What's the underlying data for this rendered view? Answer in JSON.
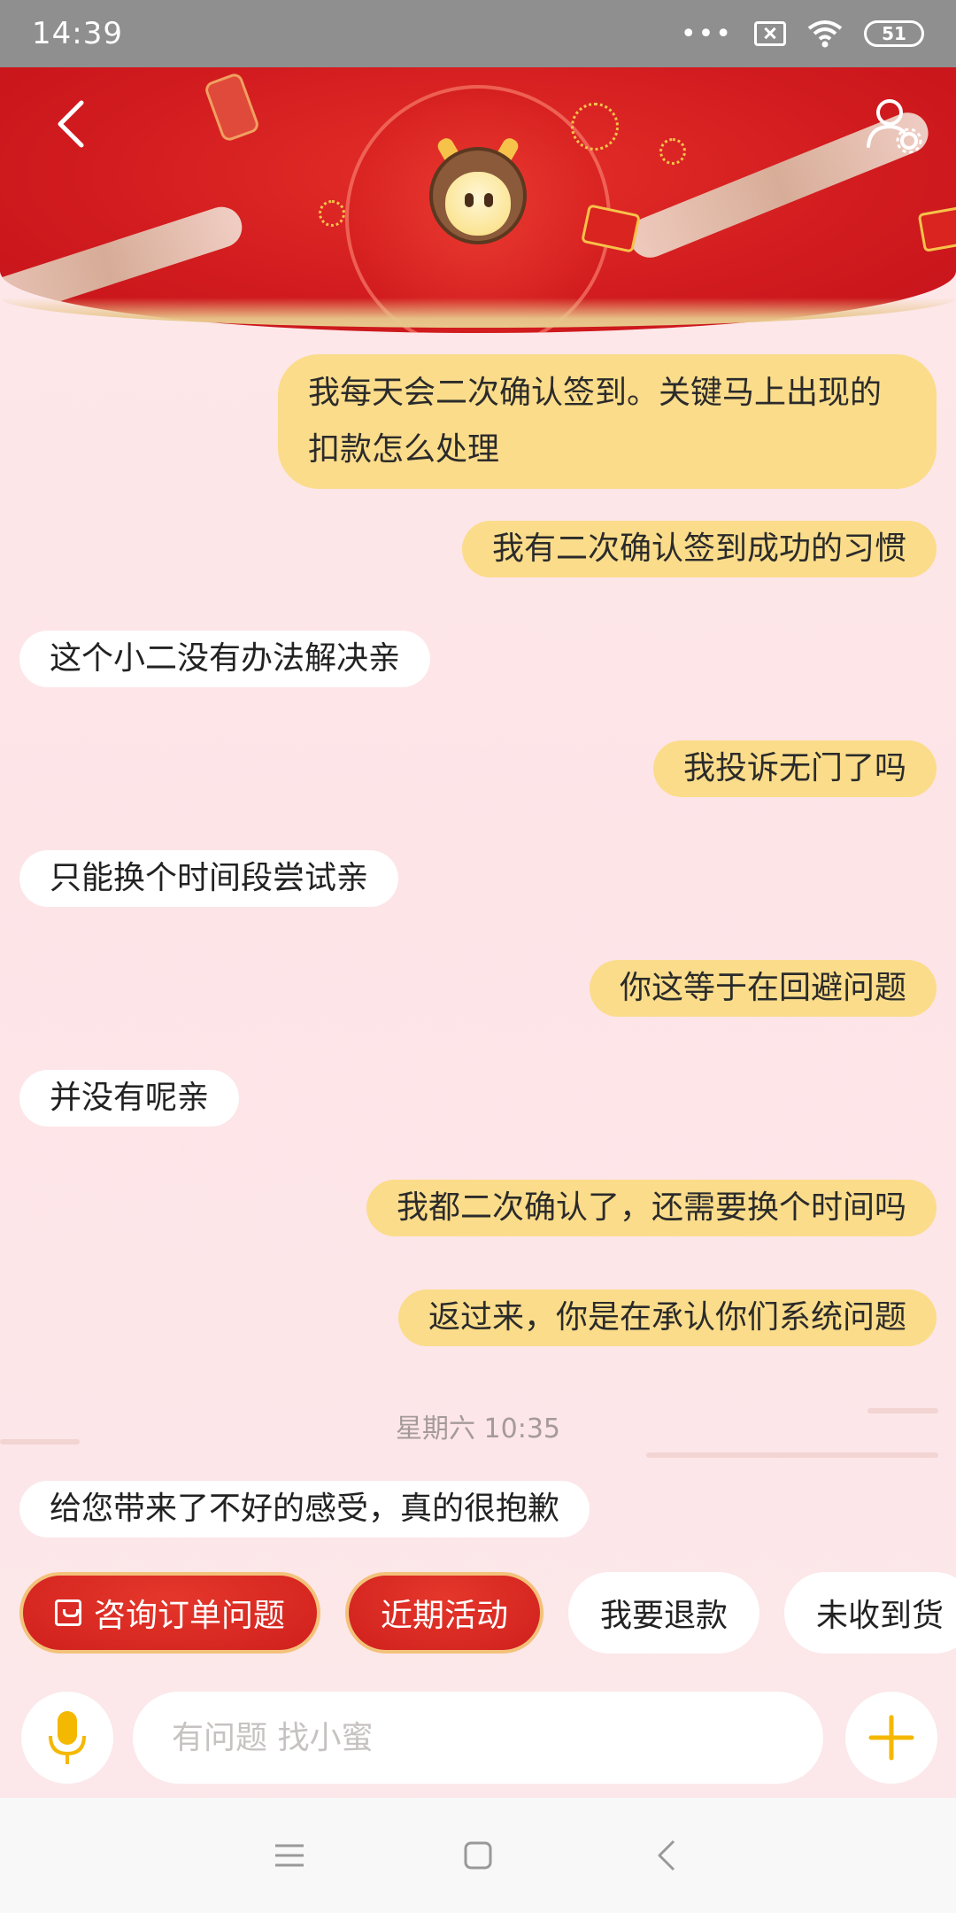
{
  "status_bar": {
    "time": "14:39",
    "more": "•••",
    "battery": "51",
    "icons": [
      "sim-off-icon",
      "wifi-icon",
      "battery-icon"
    ]
  },
  "header": {
    "back_icon": "chevron-left-icon",
    "settings_icon": "user-settings-icon",
    "mascot": "ox-mascot-avatar",
    "theme_colors": {
      "primary": "#d21c1f",
      "gold": "#e8c88c"
    }
  },
  "messages": [
    {
      "side": "out",
      "text": "我每天会二次确认签到。关键马上出现的扣款怎么处理"
    },
    {
      "side": "out",
      "text": "我有二次确认签到成功的习惯"
    },
    {
      "side": "in",
      "text": "这个小二没有办法解决亲"
    },
    {
      "side": "out",
      "text": "我投诉无门了吗"
    },
    {
      "side": "in",
      "text": "只能换个时间段尝试亲"
    },
    {
      "side": "out",
      "text": "你这等于在回避问题"
    },
    {
      "side": "in",
      "text": "并没有呢亲"
    },
    {
      "side": "out",
      "text": "我都二次确认了，还需要换个时间吗"
    },
    {
      "side": "out",
      "text": "返过来，你是在承认你们系统问题"
    },
    {
      "side": "in",
      "text": "给您带来了不好的感受，真的很抱歉"
    }
  ],
  "timestamp": "星期六 10:35",
  "quick_replies": [
    {
      "label": "咨询订单问题",
      "style": "hot",
      "icon": "order-box-icon"
    },
    {
      "label": "近期活动",
      "style": "hot"
    },
    {
      "label": "我要退款",
      "style": "plain"
    },
    {
      "label": "未收到货",
      "style": "plain"
    }
  ],
  "input": {
    "placeholder": "有问题 找小蜜",
    "value": "",
    "mic_icon": "microphone-icon",
    "plus_icon": "plus-icon",
    "accent": "#f5b800"
  },
  "nav": [
    "menu-icon",
    "home-square-icon",
    "back-triangle-icon"
  ],
  "colors": {
    "outgoing_bubble": "#fbdc8a",
    "incoming_bubble": "#ffffff",
    "background": "#fde9ea"
  }
}
